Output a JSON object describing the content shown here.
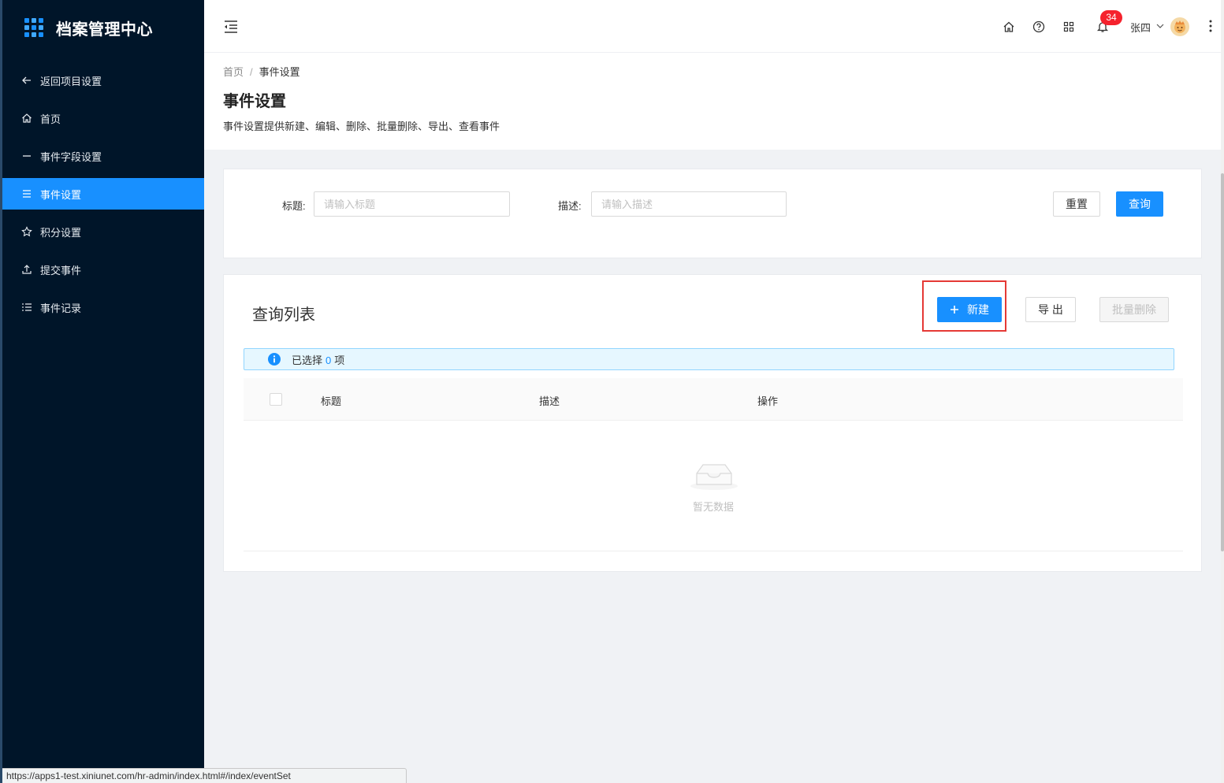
{
  "app": {
    "title": "档案管理中心"
  },
  "sidebar": {
    "items": [
      {
        "label": "返回项目设置",
        "icon": "arrow-left-icon",
        "active": false
      },
      {
        "label": "首页",
        "icon": "home-icon",
        "active": false
      },
      {
        "label": "事件字段设置",
        "icon": "dash-icon",
        "active": false
      },
      {
        "label": "事件设置",
        "icon": "list-icon",
        "active": true
      },
      {
        "label": "积分设置",
        "icon": "star-icon",
        "active": false
      },
      {
        "label": "提交事件",
        "icon": "upload-icon",
        "active": false
      },
      {
        "label": "事件记录",
        "icon": "list-bullets-icon",
        "active": false
      }
    ]
  },
  "header": {
    "notification_count": "34",
    "user_name": "张四"
  },
  "breadcrumb": {
    "home": "首页",
    "separator": "/",
    "current": "事件设置"
  },
  "page": {
    "title": "事件设置",
    "description": "事件设置提供新建、编辑、删除、批量删除、导出、查看事件"
  },
  "search": {
    "title_label": "标题:",
    "title_placeholder": "请输入标题",
    "desc_label": "描述:",
    "desc_placeholder": "请输入描述",
    "reset_label": "重置",
    "query_label": "查询"
  },
  "list": {
    "title": "查询列表",
    "new_label": "新建",
    "export_label": "导 出",
    "batch_delete_label": "批量删除",
    "selected_prefix": "已选择",
    "selected_count": "0",
    "selected_suffix": "项",
    "columns": [
      "标题",
      "描述",
      "操作"
    ],
    "empty_text": "暂无数据"
  },
  "status_bar": {
    "url": "https://apps1-test.xiniunet.com/hr-admin/index.html#/index/eventSet"
  },
  "colors": {
    "sidebar_bg": "#001529",
    "primary": "#1890ff",
    "badge": "#f5222d",
    "highlight": "#e53935"
  }
}
